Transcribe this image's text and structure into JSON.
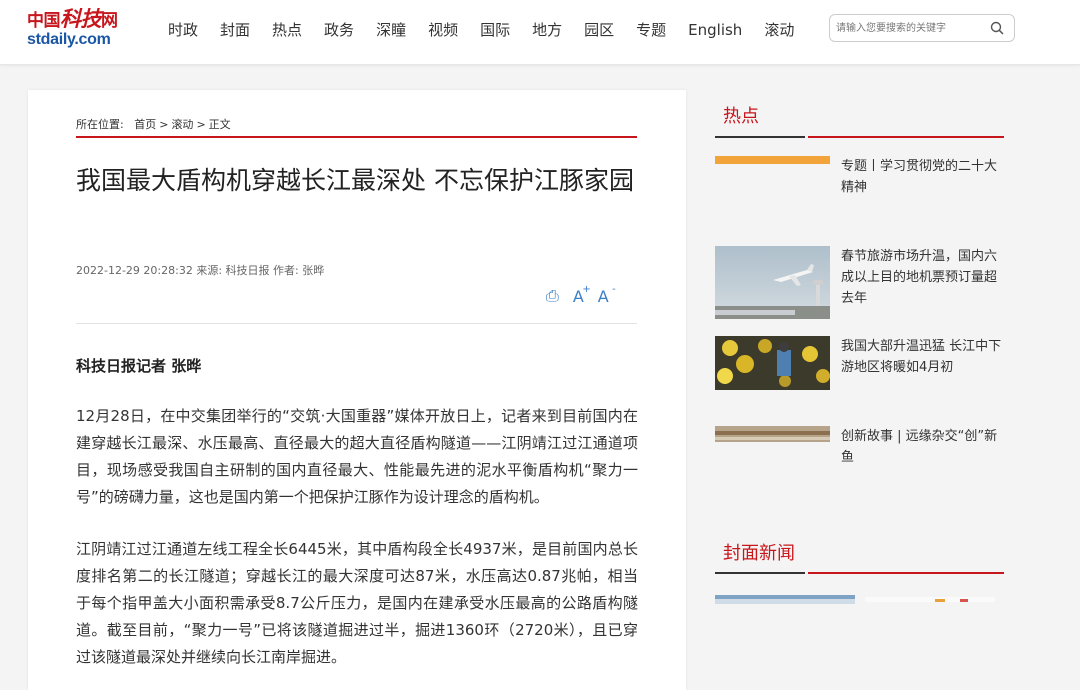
{
  "logo": {
    "cn_a": "中国",
    "cn_b": "科技",
    "cn_c": "网",
    "en": "stdaily.com"
  },
  "nav": [
    "时政",
    "封面",
    "热点",
    "政务",
    "深瞳",
    "视频",
    "国际",
    "地方",
    "园区",
    "专题",
    "English",
    "滚动"
  ],
  "search": {
    "placeholder": "请输入您要搜索的关键字"
  },
  "breadcrumb": {
    "prefix": "所在位置:",
    "items": [
      "首页",
      "滚动",
      "正文"
    ],
    "separator": ">"
  },
  "article": {
    "title": "我国最大盾构机穿越长江最深处 不忘保护江豚家园",
    "meta": "2022-12-29 20:28:32 来源: 科技日报 作者: 张晔",
    "byline": "科技日报记者 张晔",
    "paragraphs": [
      "12月28日，在中交集团举行的“交筑·大国重器”媒体开放日上，记者来到目前国内在建穿越长江最深、水压最高、直径最大的超大直径盾构隧道——江阴靖江过江通道项目，现场感受我国自主研制的国内直径最大、性能最先进的泥水平衡盾构机“聚力一号”的磅礴力量，这也是国内第一个把保护江豚作为设计理念的盾构机。",
      "江阴靖江过江通道左线工程全长6445米，其中盾构段全长4937米，是目前国内总长度排名第二的长江隧道；穿越长江的最大深度可达87米，水压高达0.87兆帕，相当于每个指甲盖大小面积需承受8.7公斤压力，是国内在建承受水压最高的公路盾构隧道。截至目前，“聚力一号”已将该隧道掘进过半，掘进1360环（2720米），且已穿过该隧道最深处并继续向长江南岸掘进。"
    ]
  },
  "tools": {
    "print": "⎙",
    "font_larger": "A",
    "font_smaller": "A"
  },
  "sidebar": {
    "hot_title": "热点",
    "hot_items": [
      {
        "text": "专题丨学习贯彻党的二十大精神"
      },
      {
        "text": "春节旅游市场升温，国内六成以上目的地机票预订量超去年"
      },
      {
        "text": "我国大部升温迅猛 长江中下游地区将暖如4月初"
      },
      {
        "text": "创新故事 | 远缘杂交“创”新鱼"
      }
    ],
    "cover_title": "封面新闻"
  },
  "colors": {
    "brand_red": "#c8161d",
    "logo_blue": "#1b57a5",
    "tool_blue": "#3b7fc4"
  }
}
